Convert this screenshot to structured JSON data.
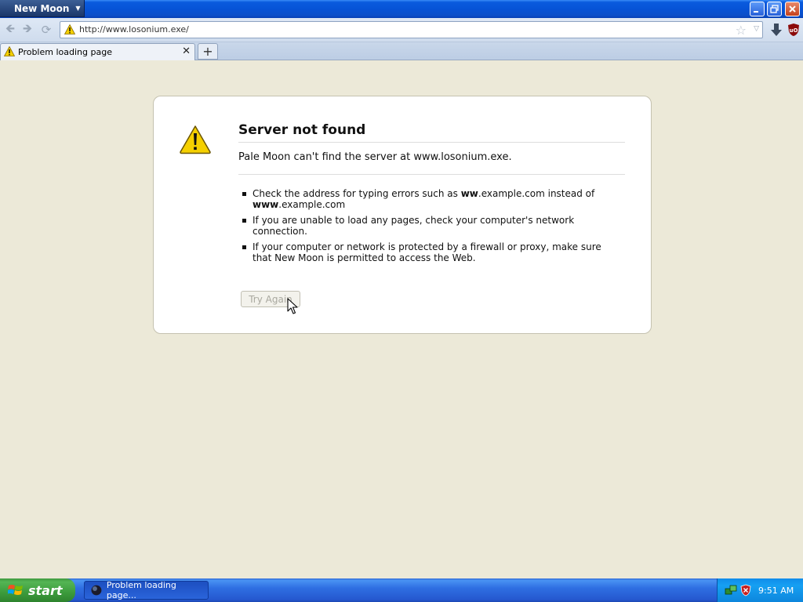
{
  "window": {
    "app_menu_label": "New Moon",
    "caret_glyph": "▼"
  },
  "navbar": {
    "back_glyph": "🡸",
    "forward_glyph": "🡺",
    "reload_glyph": "⟳",
    "url": "http://www.losonium.exe/",
    "star_glyph": "☆",
    "dropdown_glyph": "▽"
  },
  "tabs": [
    {
      "label": "Problem loading page",
      "close_glyph": "✕"
    }
  ],
  "new_tab_glyph": "+",
  "error": {
    "title": "Server not found",
    "description": "Pale Moon can't find the server at www.losonium.exe.",
    "bullets": [
      {
        "parts": [
          "Check the address for typing errors such as ",
          "ww",
          ".example.com instead of ",
          "www",
          ".example.com"
        ]
      },
      {
        "text": "If you are unable to load any pages, check your computer's network connection."
      },
      {
        "text": "If your computer or network is protected by a firewall or proxy, make sure that New Moon is permitted to access the Web."
      }
    ],
    "try_again_label": "Try Again"
  },
  "taskbar": {
    "start_label": "start",
    "task_label": "Problem loading page...",
    "clock": "9:51 AM"
  },
  "colors": {
    "page_background": "#ECE9D8",
    "warning_yellow": "#F5D000",
    "xp_blue": "#0653D6",
    "start_green": "#3C9B3C"
  },
  "icons": [
    "warning-icon",
    "minimize-icon",
    "maximize-icon",
    "close-icon",
    "back-arrow-icon",
    "forward-arrow-icon",
    "reload-icon",
    "bookmark-star-icon",
    "download-arrow-icon",
    "ublock-shield-icon",
    "mouse-pointer-icon",
    "windows-flag-icon",
    "pale-moon-globe-icon",
    "network-tray-icon",
    "security-shield-tray-icon"
  ]
}
